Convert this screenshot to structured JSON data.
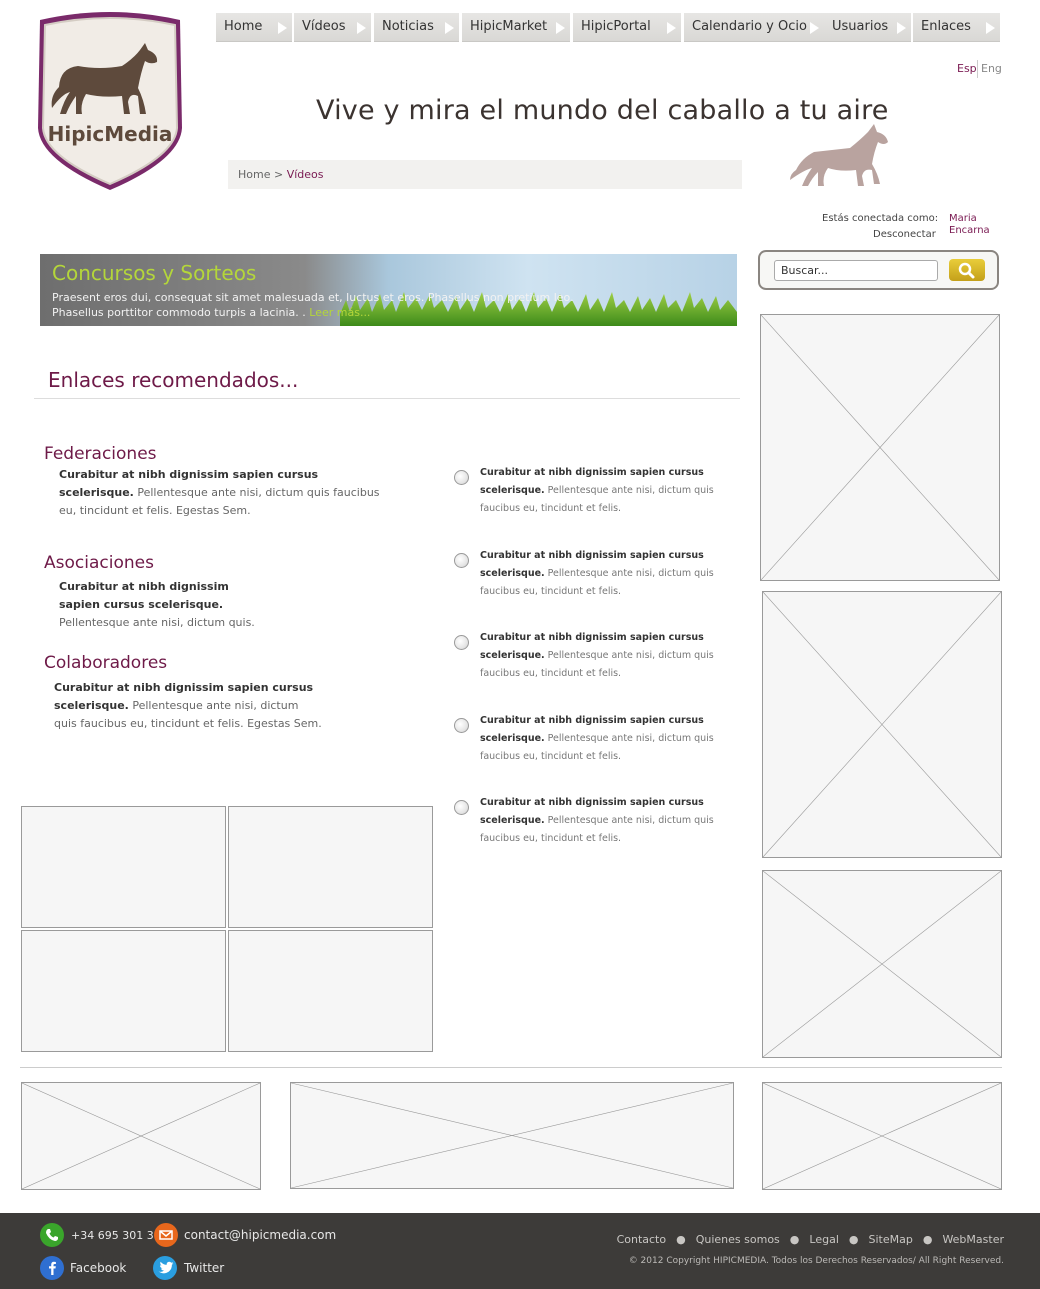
{
  "brand": {
    "logo_text": "HipicMedia",
    "accent_color": "#6e1a48",
    "shield_border": "#7a2a6a"
  },
  "nav": {
    "items": [
      {
        "label": "Home"
      },
      {
        "label": "Vídeos"
      },
      {
        "label": "Noticias"
      },
      {
        "label": "HipicMarket"
      },
      {
        "label": "HipicPortal"
      },
      {
        "label": "Calendario y Ocio"
      },
      {
        "label": "Usuarios"
      },
      {
        "label": "Enlaces"
      }
    ]
  },
  "lang": {
    "esp": "Esp",
    "eng": "Eng"
  },
  "tagline": "Vive y mira el mundo del caballo a tu aire",
  "breadcrumb": {
    "home": "Home",
    "separator": " > ",
    "current": "Vídeos"
  },
  "session": {
    "label": "Estás conectada como:",
    "user": "Maria Encarna",
    "logout": "Desconectar"
  },
  "search": {
    "placeholder": "Buscar...",
    "icon": "search-icon"
  },
  "banner": {
    "title": "Concursos y Sorteos",
    "text": "Praesent eros dui, consequat sit amet malesuada et, luctus et eros. Phasellus non pretium leo. Phasellus porttitor commodo turpis a lacinia. .",
    "more": "Leer más..."
  },
  "section": {
    "title": "Enlaces recomendados..."
  },
  "categories": [
    {
      "title": "Federaciones",
      "bold": "Curabitur at nibh dignissim sapien cursus scelerisque.",
      "text": " Pellentesque ante nisi, dictum quis faucibus eu, tincidunt et felis. Egestas Sem."
    },
    {
      "title": "Asociaciones",
      "bold": "Curabitur at nibh dignissim sapien cursus scelerisque.",
      "text": " Pellentesque ante nisi, dictum quis."
    },
    {
      "title": "Colaboradores",
      "bold": "Curabitur at nibh dignissim sapien cursus scelerisque.",
      "text": " Pellentesque ante nisi, dictum quis faucibus eu, tincidunt et felis. Egestas Sem."
    }
  ],
  "links_list": [
    {
      "bold": "Curabitur at nibh dignissim sapien cursus scelerisque.",
      "text": " Pellentesque ante nisi, dictum quis faucibus eu, tincidunt et felis."
    },
    {
      "bold": "Curabitur at nibh dignissim sapien cursus scelerisque.",
      "text": " Pellentesque ante nisi, dictum quis faucibus eu, tincidunt et felis."
    },
    {
      "bold": "Curabitur at nibh dignissim sapien cursus scelerisque.",
      "text": " Pellentesque ante nisi, dictum quis faucibus eu, tincidunt et felis."
    },
    {
      "bold": "Curabitur at nibh dignissim sapien cursus scelerisque.",
      "text": " Pellentesque ante nisi, dictum quis faucibus eu, tincidunt et felis."
    },
    {
      "bold": "Curabitur at nibh dignissim sapien cursus scelerisque.",
      "text": " Pellentesque ante nisi, dictum quis faucibus eu, tincidunt et felis."
    }
  ],
  "footer": {
    "phone": "+34 695 301 338",
    "email": "contact@hipicmedia.com",
    "facebook": "Facebook",
    "twitter": "Twitter",
    "links": [
      "Contacto",
      "Quienes somos",
      "Legal",
      "SiteMap",
      "WebMaster"
    ],
    "copyright": "© 2012 Copyright HIPICMEDIA. Todos los Derechos Reservados/ All Right Reserved.",
    "colors": {
      "phone": "#3aa52b",
      "email": "#e8671c",
      "facebook": "#2f6fd1",
      "twitter": "#2a9ee0"
    }
  }
}
